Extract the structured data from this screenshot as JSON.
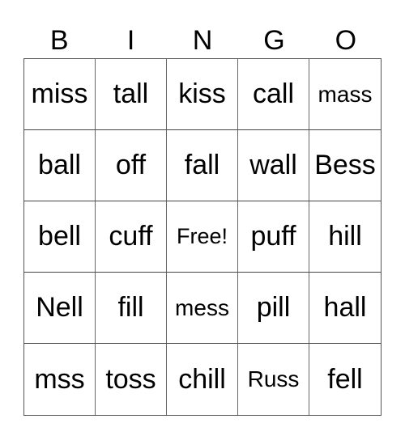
{
  "header": [
    "B",
    "I",
    "N",
    "G",
    "O"
  ],
  "cells": [
    [
      "miss",
      "tall",
      "kiss",
      "call",
      "mass"
    ],
    [
      "ball",
      "off",
      "fall",
      "wall",
      "Bess"
    ],
    [
      "bell",
      "cuff",
      "Free!",
      "puff",
      "hill"
    ],
    [
      "Nell",
      "fill",
      "mess",
      "pill",
      "hall"
    ],
    [
      "mss",
      "toss",
      "chill",
      "Russ",
      "fell"
    ]
  ]
}
